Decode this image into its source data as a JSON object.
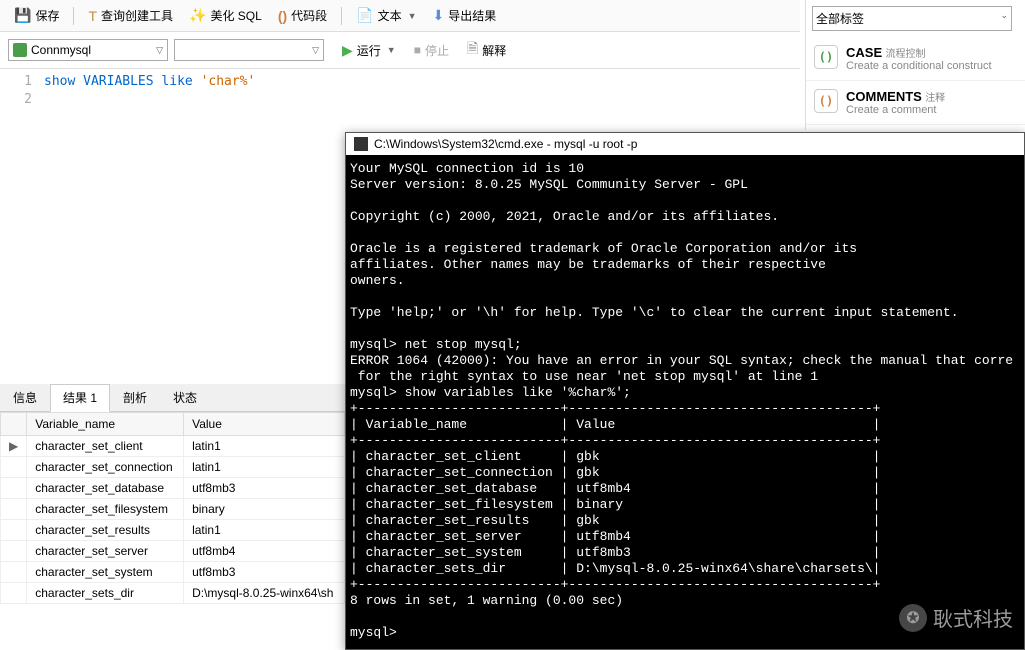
{
  "toolbar": {
    "save": "保存",
    "query_builder": "查询创建工具",
    "beautify": "美化 SQL",
    "code_segment": "代码段",
    "text": "文本",
    "export_result": "导出结果"
  },
  "conn": {
    "connection": "Connmysql",
    "run": "运行",
    "stop": "停止",
    "explain": "解释"
  },
  "editor": {
    "lines": [
      "1",
      "2"
    ],
    "code_kw1": "show",
    "code_kw2": "VARIABLES",
    "code_kw3": "like",
    "code_str": "'char%'"
  },
  "tabs": {
    "info": "信息",
    "result": "结果 1",
    "profile": "剖析",
    "status": "状态"
  },
  "result_table": {
    "headers": [
      "Variable_name",
      "Value"
    ],
    "rows": [
      {
        "ptr": "▶",
        "name": "character_set_client",
        "value": "latin1"
      },
      {
        "ptr": "",
        "name": "character_set_connection",
        "value": "latin1"
      },
      {
        "ptr": "",
        "name": "character_set_database",
        "value": "utf8mb3"
      },
      {
        "ptr": "",
        "name": "character_set_filesystem",
        "value": "binary"
      },
      {
        "ptr": "",
        "name": "character_set_results",
        "value": "latin1"
      },
      {
        "ptr": "",
        "name": "character_set_server",
        "value": "utf8mb4"
      },
      {
        "ptr": "",
        "name": "character_set_system",
        "value": "utf8mb3"
      },
      {
        "ptr": "",
        "name": "character_sets_dir",
        "value": "D:\\mysql-8.0.25-winx64\\sh"
      }
    ]
  },
  "sidebar": {
    "tag_all": "全部标签",
    "snippets": [
      {
        "title": "CASE",
        "sub": "流程控制",
        "desc": "Create a conditional construct",
        "icon": "()"
      },
      {
        "title": "COMMENTS",
        "sub": "注释",
        "desc": "Create a comment",
        "icon": "()"
      }
    ]
  },
  "cmd": {
    "title": "C:\\Windows\\System32\\cmd.exe - mysql  -u root -p",
    "body": "Your MySQL connection id is 10\nServer version: 8.0.25 MySQL Community Server - GPL\n\nCopyright (c) 2000, 2021, Oracle and/or its affiliates.\n\nOracle is a registered trademark of Oracle Corporation and/or its\naffiliates. Other names may be trademarks of their respective\nowners.\n\nType 'help;' or '\\h' for help. Type '\\c' to clear the current input statement.\n\nmysql> net stop mysql;\nERROR 1064 (42000): You have an error in your SQL syntax; check the manual that corre\n for the right syntax to use near 'net stop mysql' at line 1\nmysql> show variables like '%char%';\n+--------------------------+---------------------------------------+\n| Variable_name            | Value                                 |\n+--------------------------+---------------------------------------+\n| character_set_client     | gbk                                   |\n| character_set_connection | gbk                                   |\n| character_set_database   | utf8mb4                               |\n| character_set_filesystem | binary                                |\n| character_set_results    | gbk                                   |\n| character_set_server     | utf8mb4                               |\n| character_set_system     | utf8mb3                               |\n| character_sets_dir       | D:\\mysql-8.0.25-winx64\\share\\charsets\\|\n+--------------------------+---------------------------------------+\n8 rows in set, 1 warning (0.00 sec)\n\nmysql>"
  },
  "watermark": "耿式科技"
}
